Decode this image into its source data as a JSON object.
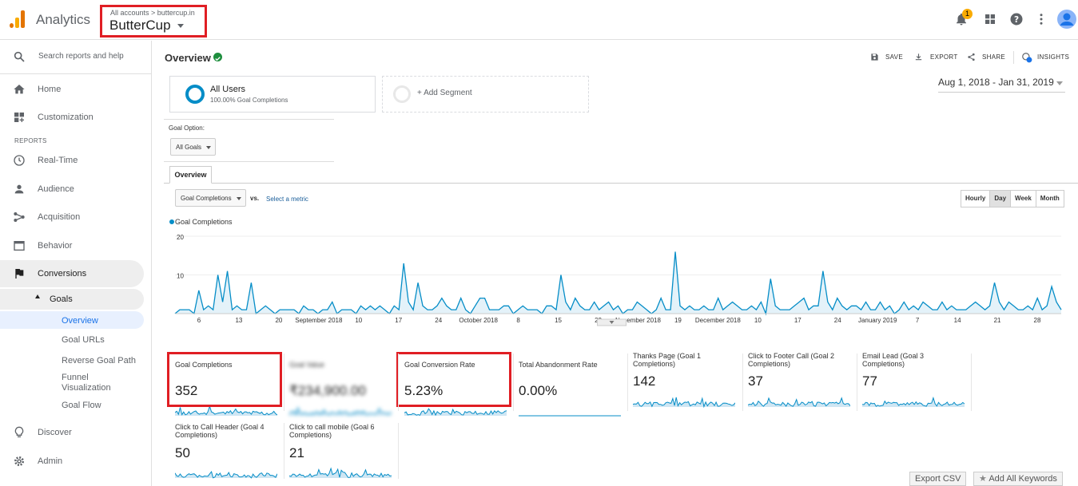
{
  "header": {
    "app_name": "Analytics",
    "account_breadcrumb": "All accounts > buttercup.in",
    "property_name": "ButterCup",
    "notification_count": "1"
  },
  "sidebar": {
    "search_placeholder": "Search reports and help",
    "home": "Home",
    "customization": "Customization",
    "reports_header": "REPORTS",
    "realtime": "Real-Time",
    "audience": "Audience",
    "acquisition": "Acquisition",
    "behavior": "Behavior",
    "conversions": "Conversions",
    "goals": "Goals",
    "goals_sub": [
      "Overview",
      "Goal URLs",
      "Reverse Goal Path",
      "Funnel Visualization",
      "Goal Flow"
    ],
    "discover": "Discover",
    "admin": "Admin"
  },
  "report": {
    "title": "Overview",
    "toolbar": {
      "save": "SAVE",
      "export": "EXPORT",
      "share": "SHARE",
      "insights": "INSIGHTS"
    },
    "segment_name": "All Users",
    "segment_sub": "100.00% Goal Completions",
    "add_segment": "+ Add Segment",
    "date_range": "Aug 1, 2018 - Jan 31, 2019",
    "goal_option_label": "Goal Option:",
    "goal_option_value": "All Goals",
    "tab": "Overview",
    "metric_select": "Goal Completions",
    "vs": "vs.",
    "select_metric": "Select a metric",
    "granularity": [
      "Hourly",
      "Day",
      "Week",
      "Month"
    ],
    "granularity_active": "Day",
    "legend": "Goal Completions",
    "export_csv": "Export CSV",
    "add_keywords": "Add All Keywords"
  },
  "chart_data": {
    "type": "area",
    "series": [
      {
        "name": "Goal Completions",
        "color": "#058dc7"
      }
    ],
    "ylim": [
      0,
      20
    ],
    "yticks": [
      20,
      10
    ],
    "xtick_labels": [
      "6",
      "13",
      "20",
      "September 2018",
      "10",
      "17",
      "24",
      "October 2018",
      "8",
      "15",
      "22",
      "November 2018",
      "19",
      "December 2018",
      "10",
      "17",
      "24",
      "January 2019",
      "7",
      "14",
      "21",
      "28"
    ],
    "values": [
      0,
      1,
      1,
      1,
      0,
      6,
      1,
      2,
      1,
      10,
      3,
      11,
      1,
      2,
      1,
      1,
      8,
      0,
      1,
      2,
      1,
      0,
      1,
      1,
      1,
      1,
      0,
      2,
      1,
      1,
      0,
      1,
      1,
      3,
      0,
      1,
      1,
      1,
      0,
      2,
      1,
      2,
      1,
      2,
      1,
      0,
      2,
      1,
      13,
      3,
      1,
      8,
      2,
      1,
      1,
      2,
      4,
      2,
      1,
      1,
      4,
      1,
      0,
      2,
      4,
      4,
      1,
      1,
      1,
      2,
      2,
      0,
      1,
      2,
      1,
      1,
      1,
      0,
      2,
      2,
      1,
      10,
      3,
      1,
      4,
      2,
      1,
      1,
      3,
      1,
      2,
      3,
      1,
      2,
      0,
      1,
      1,
      3,
      2,
      1,
      0,
      1,
      4,
      1,
      1,
      16,
      2,
      1,
      2,
      1,
      1,
      2,
      1,
      1,
      4,
      1,
      2,
      3,
      2,
      1,
      1,
      2,
      1,
      3,
      0,
      9,
      2,
      1,
      1,
      1,
      2,
      3,
      4,
      1,
      2,
      2,
      11,
      3,
      1,
      4,
      2,
      1,
      2,
      2,
      1,
      3,
      1,
      1,
      3,
      1,
      2,
      0,
      1,
      3,
      1,
      2,
      1,
      3,
      2,
      1,
      1,
      3,
      1,
      2,
      1,
      1,
      1,
      2,
      3,
      2,
      1,
      2,
      8,
      3,
      1,
      3,
      2,
      1,
      1,
      2,
      1,
      4,
      1,
      2,
      7,
      3,
      1
    ]
  },
  "metrics": [
    {
      "label": "Goal Completions",
      "value": "352",
      "highlighted": true,
      "blurred": false
    },
    {
      "label": "Goal Value",
      "value": "₹234,900.00",
      "highlighted": false,
      "blurred": true
    },
    {
      "label": "Goal Conversion Rate",
      "value": "5.23%",
      "highlighted": true,
      "blurred": false
    },
    {
      "label": "Total Abandonment Rate",
      "value": "0.00%",
      "highlighted": false,
      "blurred": false,
      "flat": true
    },
    {
      "label": "Thanks Page (Goal 1 Completions)",
      "value": "142",
      "highlighted": false,
      "blurred": false
    },
    {
      "label": "Click to Footer Call (Goal 2 Completions)",
      "value": "37",
      "highlighted": false,
      "blurred": false
    },
    {
      "label": "Email Lead (Goal 3 Completions)",
      "value": "77",
      "highlighted": false,
      "blurred": false
    },
    {
      "label": "Click to Call Header (Goal 4 Completions)",
      "value": "50",
      "highlighted": false,
      "blurred": false
    },
    {
      "label": "Click to call mobile (Goal 6 Completions)",
      "value": "21",
      "highlighted": false,
      "blurred": false
    }
  ]
}
